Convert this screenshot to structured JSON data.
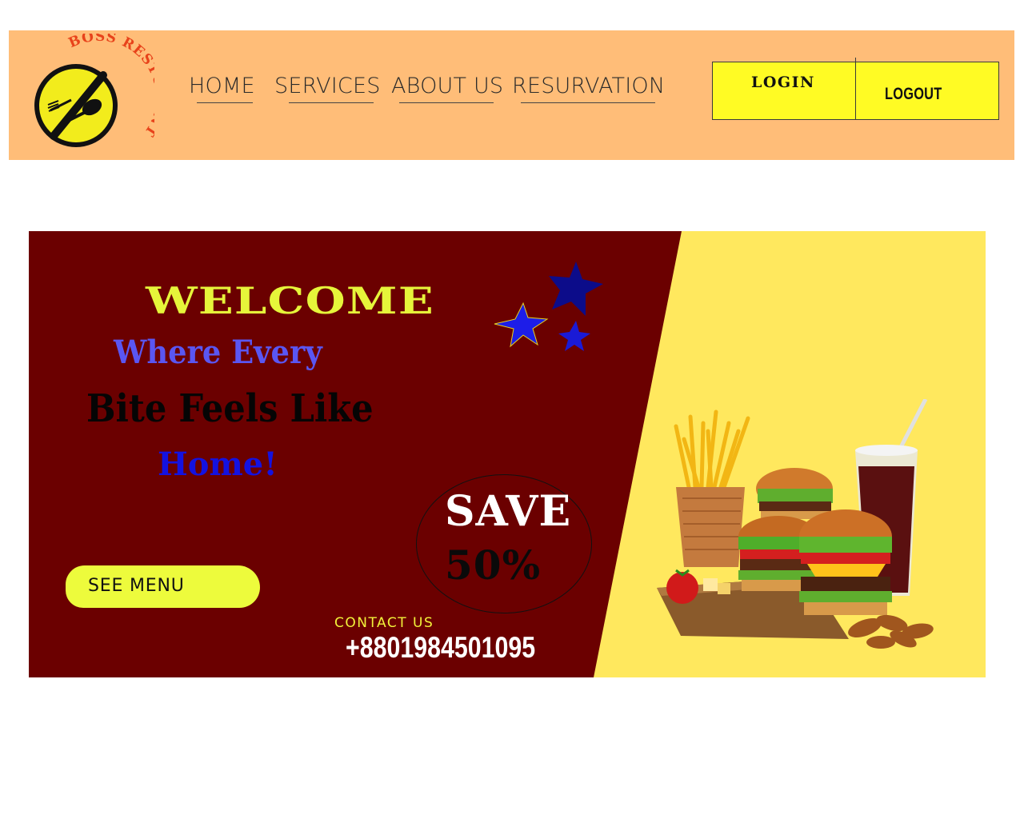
{
  "brand": {
    "logo_text": "BOSS RESTURENT",
    "colors": {
      "header_bg": "#ffbd78",
      "accent_yellow": "#fffb24",
      "banner_red": "#6b0000",
      "banner_yellow": "#ffe85e"
    }
  },
  "nav": {
    "items": [
      {
        "label": "HOME"
      },
      {
        "label": "SERVICES"
      },
      {
        "label": "ABOUT US"
      },
      {
        "label": "RESURVATION"
      }
    ]
  },
  "auth": {
    "login_label": "LOGIN",
    "logout_label": "LOGOUT"
  },
  "hero": {
    "welcome": "WELCOME",
    "tagline_1": "Where Every",
    "tagline_2": "Bite Feels Like",
    "tagline_3": "Home!",
    "cta_label": "SEE MENU",
    "offer_line_1": "SAVE",
    "offer_line_2": "50%",
    "contact_label": "CONTACT US",
    "contact_phone": "+8801984501095",
    "icons": [
      "star-icon",
      "fork-icon",
      "spoon-icon",
      "burger-icon",
      "fries-icon",
      "drink-icon"
    ]
  }
}
